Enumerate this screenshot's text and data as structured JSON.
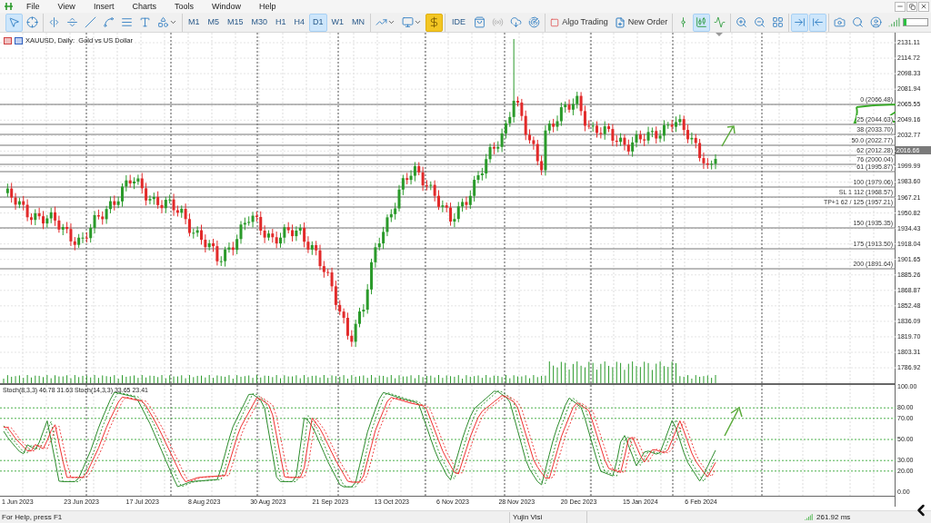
{
  "menu": [
    "File",
    "View",
    "Insert",
    "Charts",
    "Tools",
    "Window",
    "Help"
  ],
  "toolbar": {
    "groups": [
      [
        {
          "kind": "cursor",
          "selected": true
        },
        {
          "kind": "crosshair",
          "selected": false
        }
      ],
      [
        {
          "kind": "vline",
          "selected": false
        },
        {
          "kind": "hline",
          "selected": false
        },
        {
          "kind": "trendline",
          "selected": false
        },
        {
          "kind": "channel",
          "selected": false
        },
        {
          "kind": "fibo",
          "selected": false
        },
        {
          "kind": "text",
          "selected": false
        },
        {
          "kind": "shapes",
          "selected": false
        }
      ],
      [
        {
          "kind": "timeframe",
          "label": "M1",
          "selected": false
        },
        {
          "kind": "timeframe",
          "label": "M5",
          "selected": false
        },
        {
          "kind": "timeframe",
          "label": "M15",
          "selected": false
        },
        {
          "kind": "timeframe",
          "label": "M30",
          "selected": false
        },
        {
          "kind": "timeframe",
          "label": "H1",
          "selected": false
        },
        {
          "kind": "timeframe",
          "label": "H4",
          "selected": false
        },
        {
          "kind": "timeframe",
          "label": "D1",
          "selected": true
        },
        {
          "kind": "timeframe",
          "label": "W1",
          "selected": false
        },
        {
          "kind": "timeframe",
          "label": "MN",
          "selected": false
        }
      ],
      [
        {
          "kind": "indicators"
        },
        {
          "kind": "templates"
        },
        {
          "kind": "dollar"
        }
      ],
      [
        {
          "kind": "ide",
          "label": "IDE"
        },
        {
          "kind": "bag"
        },
        {
          "kind": "radio"
        },
        {
          "kind": "cloud"
        },
        {
          "kind": "radar"
        }
      ],
      [
        {
          "kind": "algo",
          "label": "Algo Trading"
        },
        {
          "kind": "order",
          "label": "New Order"
        }
      ],
      [
        {
          "kind": "bars",
          "selected": false
        },
        {
          "kind": "candles",
          "selected": true
        },
        {
          "kind": "line",
          "selected": false
        }
      ],
      [
        {
          "kind": "zoomin"
        },
        {
          "kind": "zoomout"
        },
        {
          "kind": "tile"
        }
      ],
      [
        {
          "kind": "autoscroll",
          "selected": true
        },
        {
          "kind": "shift",
          "selected": true
        }
      ],
      [
        {
          "kind": "camera"
        },
        {
          "kind": "search"
        },
        {
          "kind": "user"
        },
        {
          "kind": "signal"
        }
      ]
    ]
  },
  "chart": {
    "title": "XAUUSD, Daily:  Gold vs US Dollar",
    "price_ticks": [
      "2131.11",
      "2114.72",
      "2098.33",
      "2081.94",
      "2065.55",
      "2049.16",
      "2032.77",
      "1999.99",
      "1983.60",
      "1967.21",
      "1950.82",
      "1934.43",
      "1918.04",
      "1901.65",
      "1885.26",
      "1868.87",
      "1852.48",
      "1836.09",
      "1819.70",
      "1803.31",
      "1786.92"
    ],
    "current_price": "2016.66",
    "fib_levels": [
      "0 (2066.48)",
      "25 (2044.63)",
      "38 (2033.70)",
      "50.0 (2022.77)",
      "62 (2012.28)",
      "76 (2000.04)",
      "61 (1995.87)",
      "100 (1979.06)",
      "SL 1 112 (1968.57)",
      "TP+1 62 / 125 (1957.21)",
      "150 (1935.35)",
      "175 (1913.50)",
      "200 (1891.64)"
    ],
    "indicator_label": "Stoch(8,3,3) 46.78 31.63 Stoch(14,3,3) 33.65 23.41",
    "indicator_ticks": [
      "100.00",
      "80.00",
      "70.00",
      "50.00",
      "30.00",
      "20.00",
      "0.00"
    ],
    "dates": [
      "1 Jun 2023",
      "23 Jun 2023",
      "17 Jul 2023",
      "8 Aug 2023",
      "30 Aug 2023",
      "21 Sep 2023",
      "13 Oct 2023",
      "6 Nov 2023",
      "28 Nov 2023",
      "20 Dec 2023",
      "15 Jan 2024",
      "6 Feb 2024"
    ]
  },
  "status_bar": {
    "help": "For Help, press F1",
    "profile": "Yujin Visi",
    "ping": "261.92 ms"
  }
}
